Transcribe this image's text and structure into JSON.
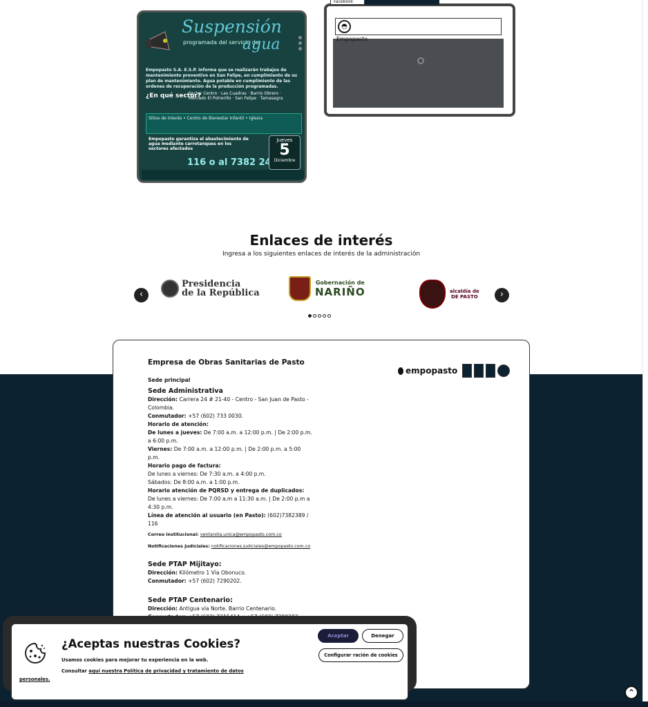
{
  "widget": {
    "tab_label": "Facebook",
    "page_label": "Empopasto"
  },
  "poster": {
    "title": "Suspensión",
    "subtitle": "programada del servicio de",
    "word": "agua",
    "body": "Empopasto S.A. E.S.P. informa que se realizarán trabajos de mantenimiento preventivo en San Felipe, en cumplimiento de su plan de mantenimiento. Agua potable en cumplimiento de las ordenes de recuperación de la producción programadas.",
    "question": "¿En qué sector?",
    "zones": "Sector Centro · Las Cuadras · Barrio Obrero · Mercado El Potrerillo · San Felipe · Tamasagra",
    "row_label": "Sitios de interés",
    "row_items": "• Centro de Bienestar Infantil • Iglesia",
    "footer": "Empopasto garantiza el abastecimiento de agua mediante carrotanques en los sectores afectados",
    "phone": "116 o al 7382 24 89",
    "date_day_name": "Jueves",
    "date_day": "5",
    "date_month": "Diciembre"
  },
  "enlaces": {
    "title": "Enlaces de interés",
    "subtitle": "Ingresa a los siguientes enlaces de interés de la administración",
    "logos": [
      {
        "line1": "Presidencia",
        "line2": "de la República"
      },
      {
        "line1": "Gobernación de",
        "line2": "NARIÑO"
      },
      {
        "line1": "alcaldía de",
        "line2": "DE PASTO"
      }
    ],
    "prev": "‹",
    "next": "›"
  },
  "contact": {
    "company": "Empresa de Obras Sanitarias de Pasto",
    "logo_name": "empopasto",
    "sede_label": "Sede principal",
    "admin": {
      "title": "Sede Administrativa",
      "dir_label": "Dirección:",
      "dir": "Carrera 24 # 21-40 - Centro - San Juan de Pasto - Colombia.",
      "conm_label": "Conmutador:",
      "conm": "+57 (602) 733 0030.",
      "horario_label": "Horario de atención:",
      "lj_label": "De lunes a jueves:",
      "lj": "De 7:00 a.m. a 12:00 p.m. | De 2:00 p.m. a 6:00 p.m.",
      "vi_label": "Viernes:",
      "vi": "De 7:00 a.m. a 12:00 p.m. | De 2:00 p.m. a 5:00 p.m.",
      "pago_label": "Horario pago de factura:",
      "pago_lv": "De lunes a viernes: De 7:30 a.m. a 4:00 p.m.",
      "pago_sab": "Sábados: De 8:00 a.m. a 1:00 p.m.",
      "pqrsd_label": "Horario atención de PQRSD y entrega de duplicados:",
      "pqrsd": "De lunes a viernes: De 7:00 a.m a 11:30 a.m. | De 2:00 p.m a 4:30 p.m.",
      "linea_label": "Línea de atención al usuario (en Pasto):",
      "linea": "(602)7382389 / 116",
      "correo_label": "Correo institucional:",
      "correo": "ventanilla.unica@empopasto.com.co",
      "notif_label": "Notificaciones judiciales:",
      "notif": "notificaciones.judiciales@empopasto.com.co"
    },
    "miljitayo": {
      "title": "Sede PTAP Mijitayo:",
      "dir_label": "Dirección:",
      "dir": "Kilómetro 1 Vía Obonuco.",
      "conm_label": "Conmutador:",
      "conm": "+57 (602) 7290202."
    },
    "centenario": {
      "title": "Sede PTAP Centenario:",
      "dir_label": "Dirección:",
      "dir": "Antigua vía Norte. Barrio Centenario.",
      "conm_label": "Conmutador:",
      "conm": "+57 (602) 7215414 y +57 (602) 7290202."
    }
  },
  "cookies": {
    "title": "¿Aceptas nuestras Cookies?",
    "text1": "Usamos cookies para mejorar tu experiencia en la web.",
    "text2_prefix": "Consultar",
    "text2_link": "aquí nuestra Política de privacidad y tratamiento de datos",
    "text3_link": "personales.",
    "accept": "Aceptar",
    "deny": "Denegar",
    "config": "Configurar ración de cookies"
  },
  "scroll_top": "⌃"
}
